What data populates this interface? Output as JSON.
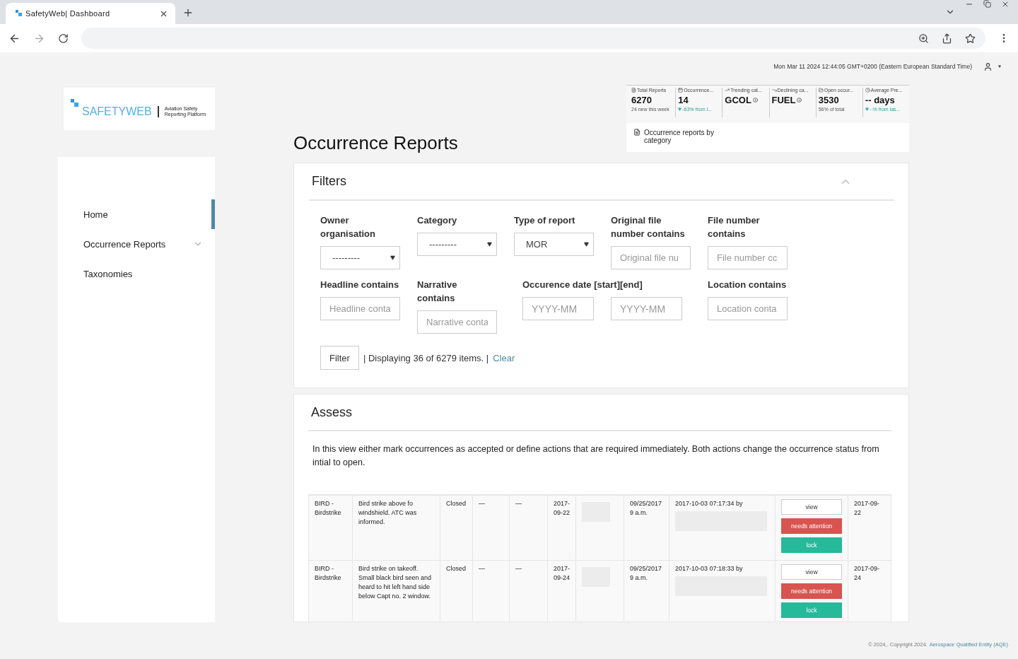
{
  "browser": {
    "tab_title": "SafetyWeb| Dashboard"
  },
  "header": {
    "datetime": "Mon Mar 11 2024 12:44:05 GMT+0200 (Eastern European Standard Time)"
  },
  "logo": {
    "name": "SAFETYWEB",
    "tagline": [
      "Aviation Safety",
      "Reporting Platform"
    ]
  },
  "sidebar": {
    "items": [
      {
        "label": "Home",
        "selected": true,
        "expandable": false
      },
      {
        "label": "Occurrence Reports",
        "selected": false,
        "expandable": true
      },
      {
        "label": "Taxonomies",
        "selected": false,
        "expandable": false
      }
    ]
  },
  "stats": [
    {
      "label": "Total Reports",
      "value": "6270",
      "info": false,
      "note": "24 new this week",
      "trend_down": false
    },
    {
      "label": "Occurrence...",
      "value": "14",
      "info": false,
      "note": "-63% from l...",
      "trend_down": true
    },
    {
      "label": "Trending cat...",
      "value": "GCOL",
      "info": true
    },
    {
      "label": "Declining ca...",
      "value": "FUEL",
      "info": true
    },
    {
      "label": "Open occur...",
      "value": "3530",
      "info": false,
      "note": "56% of total",
      "trend_down": false
    },
    {
      "label": "Average Pre...",
      "value": "-- days",
      "info": false,
      "note": "--% from las...",
      "trend_down": true
    }
  ],
  "category_card": {
    "title": "Occurrence reports by category"
  },
  "page_title": "Occurrence Reports",
  "filters": {
    "title": "Filters",
    "expanded": true,
    "fields": [
      {
        "kind": "select",
        "label": "Owner organisation",
        "value": "---------"
      },
      {
        "kind": "select",
        "label": "Category",
        "value": "---------"
      },
      {
        "kind": "select",
        "label": "Type of report",
        "value": "MOR"
      },
      {
        "kind": "text",
        "label": "Original file number contains",
        "placeholder": "Original file nu"
      },
      {
        "kind": "text",
        "label": "File number contains",
        "placeholder": "File number cc"
      },
      {
        "kind": "text",
        "label": "Headline contains",
        "placeholder": "Headline conta"
      },
      {
        "kind": "text",
        "label": "Narrative contains",
        "placeholder": "Narrative conta"
      },
      {
        "kind": "range",
        "label": "Occurence date [start][end]",
        "placeholders": [
          "YYYY-MM",
          "YYYY-MM"
        ]
      },
      {
        "kind": "text",
        "label": "Location contains",
        "placeholder": "Location conta"
      }
    ],
    "button": "Filter",
    "result": "| Displaying 36 of 6279 items. |",
    "clear": "Clear"
  },
  "assess": {
    "title": "Assess",
    "description": "In this view either mark occurrences as accepted or define actions that are required immediately. Both actions change the occurrence status from intial to open.",
    "rows": [
      {
        "category": "BIRD - Birdstrike",
        "narrative": "Bird strike above fo windshield. ATC was informed.",
        "status": "Closed",
        "column_4": "—",
        "column_5": "—",
        "date": "2017-09-22",
        "reported": "09/25/2017 9 a.m.",
        "modified": "2017-10-03 07:17:34 by",
        "actions": [
          {
            "label": "view",
            "kind": "default"
          },
          {
            "label": "needs attention",
            "kind": "danger"
          },
          {
            "label": "lock",
            "kind": "success"
          }
        ],
        "last_date": "2017-09-22"
      },
      {
        "category": "BIRD - Birdstrike",
        "narrative": "Bird strike on takeoff. Small black bird seen and heard to hit left hand side below Capt no. 2 window.",
        "status": "Closed",
        "column_4": "—",
        "column_5": "—",
        "date": "2017-09-24",
        "reported": "09/25/2017 9 a.m.",
        "modified": "2017-10-03 07:18:33 by",
        "actions": [
          {
            "label": "view",
            "kind": "default"
          },
          {
            "label": "needs attention",
            "kind": "danger"
          },
          {
            "label": "lock",
            "kind": "success"
          }
        ],
        "last_date": "2017-09-24"
      }
    ]
  },
  "footer": {
    "copyright": "© 2024,. Copyright 2024.",
    "link": "Aerospace Qualified Entity (AQE)"
  }
}
